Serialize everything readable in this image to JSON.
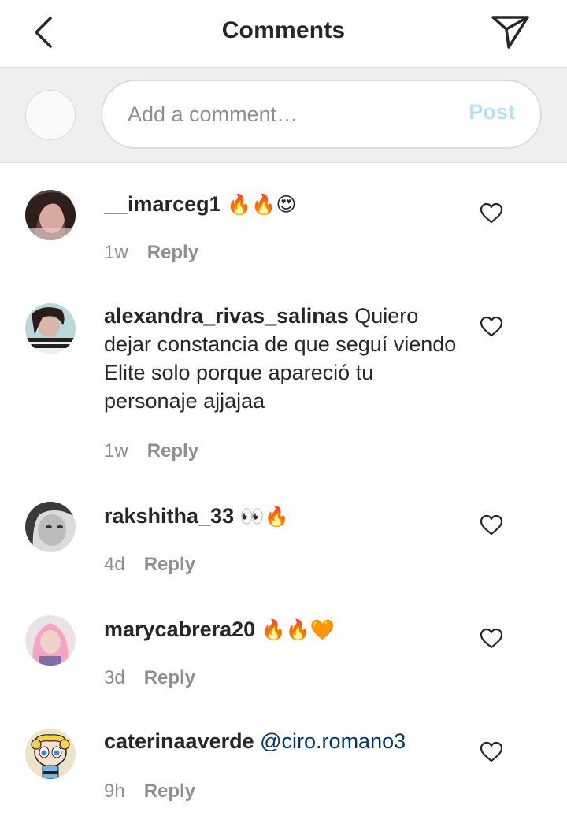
{
  "header": {
    "title": "Comments",
    "back_icon": "chevron-left-icon",
    "share_icon": "paper-plane-icon"
  },
  "composer": {
    "placeholder": "Add a comment…",
    "post_label": "Post",
    "post_color": "#b2dffc"
  },
  "colors": {
    "text": "#262626",
    "secondary": "#8e8e8e",
    "mention": "#00376b",
    "divider": "#dbdbdb",
    "composer_bg": "#efefef"
  },
  "comments": [
    {
      "username": "__imarceg1",
      "text": "🔥🔥😍",
      "time": "1w",
      "reply": "Reply"
    },
    {
      "username": "alexandra_rivas_salinas",
      "text": "Quiero dejar constancia de que seguí viendo Elite solo porque apareció tu personaje ajjajaa",
      "time": "1w",
      "reply": "Reply"
    },
    {
      "username": "rakshitha_33",
      "text": "👀🔥",
      "time": "4d",
      "reply": "Reply"
    },
    {
      "username": "marycabrera20",
      "text": "🔥🔥🧡",
      "time": "3d",
      "reply": "Reply"
    },
    {
      "username": "caterinaaverde",
      "mention": "@ciro.romano3",
      "time": "9h",
      "reply": "Reply"
    }
  ]
}
